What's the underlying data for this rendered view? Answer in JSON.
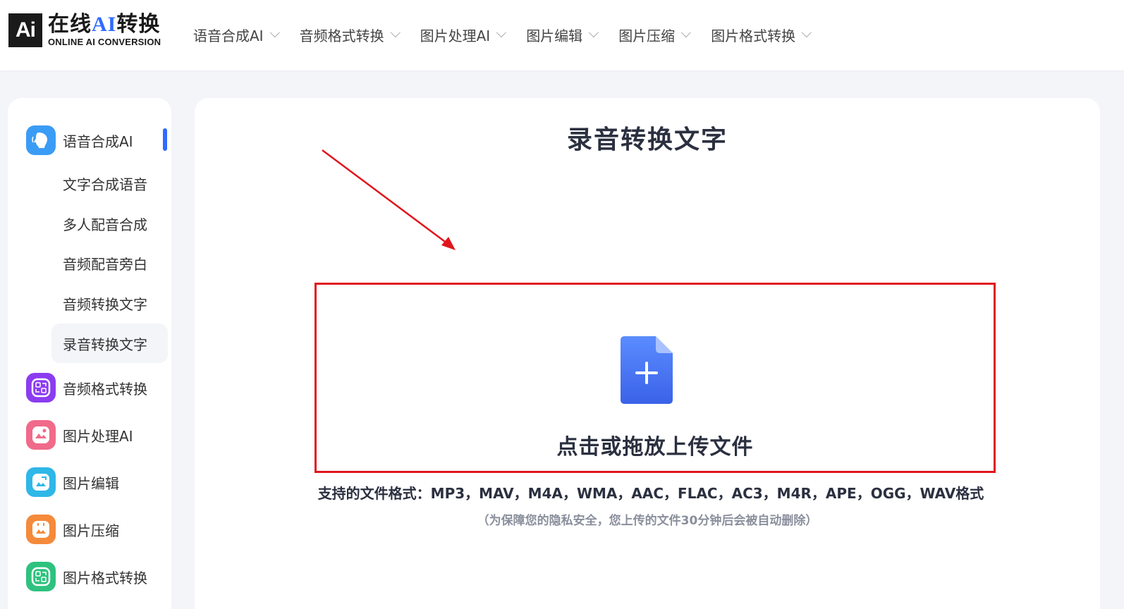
{
  "logo": {
    "mark": "Ai",
    "cn_prefix": "在线",
    "cn_ai": "AI",
    "cn_suffix": "转换",
    "en": "ONLINE AI CONVERSION"
  },
  "nav": {
    "items": [
      {
        "label": "语音合成AI"
      },
      {
        "label": "音频格式转换"
      },
      {
        "label": "图片处理AI"
      },
      {
        "label": "图片编辑"
      },
      {
        "label": "图片压缩"
      },
      {
        "label": "图片格式转换"
      }
    ]
  },
  "sidebar": {
    "categories": [
      {
        "label": "语音合成AI",
        "icon": "voice-synthesis-icon",
        "color": "#3b9cf5"
      },
      {
        "label": "音频格式转换",
        "icon": "audio-convert-icon",
        "color": "#8b3cf0"
      },
      {
        "label": "图片处理AI",
        "icon": "image-ai-icon",
        "color": "#f06a8a"
      },
      {
        "label": "图片编辑",
        "icon": "image-edit-icon",
        "color": "#2fb7e8"
      },
      {
        "label": "图片压缩",
        "icon": "image-compress-icon",
        "color": "#f58a3a"
      },
      {
        "label": "图片格式转换",
        "icon": "image-format-icon",
        "color": "#2ec27e"
      }
    ],
    "sub_items": [
      {
        "label": "文字合成语音"
      },
      {
        "label": "多人配音合成"
      },
      {
        "label": "音频配音旁白"
      },
      {
        "label": "音频转换文字"
      },
      {
        "label": "录音转换文字"
      }
    ],
    "active_sub": "录音转换文字"
  },
  "main": {
    "title": "录音转换文字",
    "upload_label": "点击或拖放上传文件",
    "upload_icon": "file-plus-icon",
    "formats": "支持的文件格式：MP3，MAV，M4A，WMA，AAC，FLAC，AC3，M4R，APE，OGG，WAV格式",
    "privacy": "（为保障您的隐私安全，您上传的文件30分钟后会被自动删除）"
  },
  "annotation_colors": {
    "arrow": "#e0161c",
    "box": "#e0161c",
    "accent": "#2f6bff"
  }
}
